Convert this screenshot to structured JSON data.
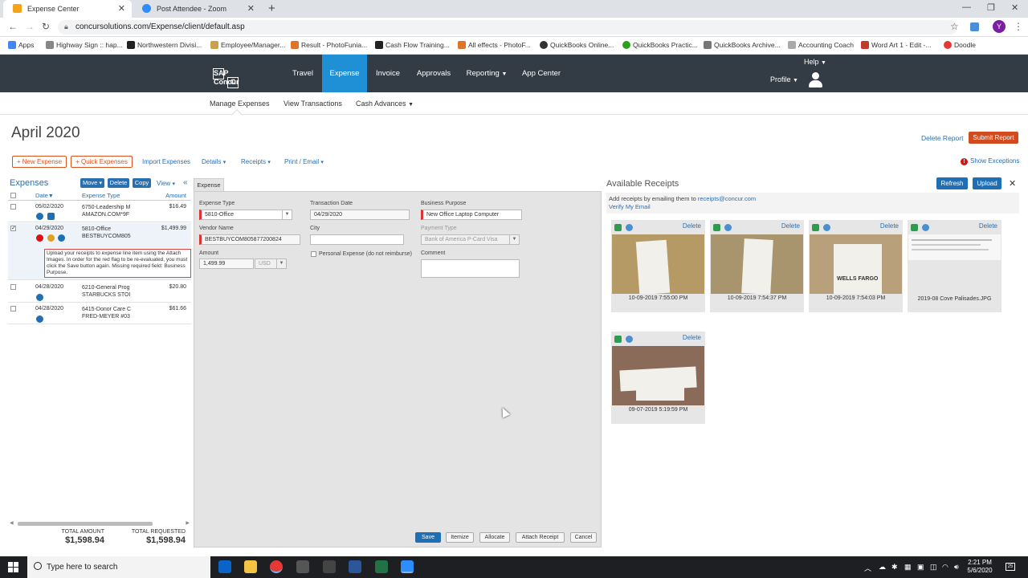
{
  "browser": {
    "tabs": [
      {
        "title": "Expense Center",
        "active": true
      },
      {
        "title": "Post Attendee - Zoom",
        "active": false
      }
    ],
    "url": "concursolutions.com/Expense/client/default.asp",
    "avatar_letter": "Y",
    "bookmarks": [
      "Apps",
      "Highway Sign :: hap...",
      "Northwestern Divisi...",
      "Employee/Manager...",
      "Result - PhotoFunia...",
      "Cash Flow Training...",
      "All effects - PhotoF...",
      "QuickBooks Online...",
      "QuickBooks Practic...",
      "QuickBooks Archive...",
      "Accounting Coach",
      "Word Art 1 - Edit -...",
      "Doodle"
    ]
  },
  "header": {
    "logo": "SAP Concur",
    "logo_mark": "C",
    "nav": [
      "Travel",
      "Expense",
      "Invoice",
      "Approvals",
      "Reporting",
      "App Center"
    ],
    "help": "Help",
    "profile": "Profile"
  },
  "subnav": [
    "Manage Expenses",
    "View Transactions",
    "Cash Advances"
  ],
  "report": {
    "title": "April 2020",
    "delete_report": "Delete Report",
    "submit_report": "Submit Report",
    "show_exceptions": "Show Exceptions",
    "toolbar": {
      "new_expense": "+ New Expense",
      "quick_expenses": "+ Quick Expenses",
      "import_expenses": "Import Expenses",
      "details": "Details",
      "receipts": "Receipts",
      "print_email": "Print / Email"
    }
  },
  "expenses": {
    "title": "Expenses",
    "move": "Move",
    "delete": "Delete",
    "copy": "Copy",
    "view": "View",
    "collapse": "«",
    "columns": [
      "Date",
      "Expense Type",
      "Amount"
    ],
    "rows": [
      {
        "date": "05/02/2020",
        "type": "6750-Leadership M",
        "vendor": "AMAZON.COM*9F",
        "amount": "$16.49",
        "checked": false
      },
      {
        "date": "04/29/2020",
        "type": "5810-Office",
        "vendor": "BESTBUYCOM805",
        "amount": "$1,499.99",
        "checked": true
      },
      {
        "date": "04/28/2020",
        "type": "6210-General Prog",
        "vendor": "STARBUCKS STOI",
        "amount": "$20.80",
        "checked": false
      },
      {
        "date": "04/28/2020",
        "type": "6415-Donor Care C",
        "vendor": "FRED-MEYER #03",
        "amount": "$61.66",
        "checked": false
      }
    ],
    "error_message": "Upload your receipts to expense line item using the Attach Images. In order for the red flag to be re-evaluated, you must click the Save button again. Missing required field: Business Purpose.",
    "total_amount_label": "TOTAL AMOUNT",
    "total_amount": "$1,598.94",
    "total_requested_label": "TOTAL REQUESTED",
    "total_requested": "$1,598.94"
  },
  "form": {
    "tab": "Expense",
    "expense_type_label": "Expense Type",
    "expense_type": "5810-Office",
    "transaction_date_label": "Transaction Date",
    "transaction_date": "04/29/2020",
    "business_purpose_label": "Business Purpose",
    "business_purpose": "New Office Laptop Computer",
    "vendor_name_label": "Vendor Name",
    "vendor_name": "BESTBUYCOM805877200824",
    "city_label": "City",
    "city": "",
    "payment_type_label": "Payment Type",
    "payment_type": "Bank of America P-Card Visa",
    "personal_expense_label": "Personal Expense (do not reimburse)",
    "amount_label": "Amount",
    "amount": "1,499.99",
    "currency": "USD",
    "comment_label": "Comment",
    "comment": "",
    "buttons": {
      "save": "Save",
      "itemize": "Itemize",
      "allocate": "Allocate",
      "attach_receipt": "Attach Receipt",
      "cancel": "Cancel"
    }
  },
  "receipts": {
    "title": "Available Receipts",
    "refresh": "Refresh",
    "upload": "Upload",
    "close": "✕",
    "info_prefix": "Add receipts by emailing them to ",
    "email": "receipts@concur.com",
    "verify": "Verify My Email",
    "delete_label": "Delete",
    "items": [
      {
        "label": "10-09-2019 7:55:00 PM"
      },
      {
        "label": "10-09-2019 7:54:37 PM"
      },
      {
        "label": "10-09-2019 7:54:03 PM",
        "image_text": "WELLS FARGO"
      },
      {
        "label": "2019-08 Cove Palisades.JPG"
      },
      {
        "label": "09-07-2019 5:19:59 PM"
      }
    ]
  },
  "taskbar": {
    "search_placeholder": "Type here to search",
    "time": "2:21 PM",
    "date": "5/6/2020",
    "notifications": "25"
  },
  "colors": {
    "nav_bg": "#333b44",
    "nav_active": "#1f8fd6",
    "accent_orange": "#d24b1e",
    "link_blue": "#2a6fb0",
    "button_blue": "#1f6fb6"
  }
}
